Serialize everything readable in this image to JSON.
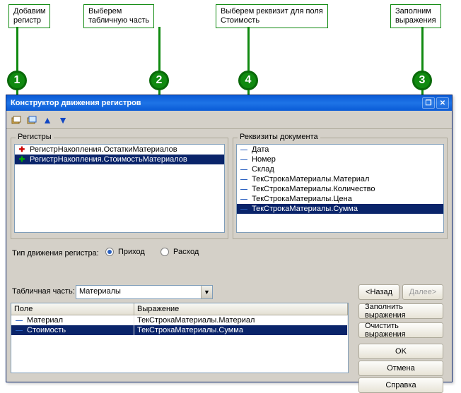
{
  "callouts": {
    "c1": "Добавим\nрегистр",
    "c2": "Выберем\nтабличную часть",
    "c3": "Заполним\nвыражения",
    "c4": "Выберем реквизит для поля\nСтоимость",
    "n1": "1",
    "n2": "2",
    "n3": "3",
    "n4": "4"
  },
  "window": {
    "title": "Конструктор движения регистров"
  },
  "groups": {
    "registers": "Регистры",
    "doc_attributes": "Реквизиты документа"
  },
  "registers_items": [
    {
      "icon": "plus-red",
      "text": "РегистрНакопления.ОстаткиМатериалов"
    },
    {
      "icon": "plus-green",
      "text": "РегистрНакопления.СтоимостьМатериалов",
      "selected": true
    }
  ],
  "doc_items": [
    {
      "icon": "dash-blue",
      "text": "Дата"
    },
    {
      "icon": "dash-blue",
      "text": "Номер"
    },
    {
      "icon": "dash-blue",
      "text": "Склад"
    },
    {
      "icon": "dash-blue",
      "text": "ТекСтрокаМатериалы.Материал"
    },
    {
      "icon": "dash-blue",
      "text": "ТекСтрокаМатериалы.Количество"
    },
    {
      "icon": "dash-blue",
      "text": "ТекСтрокаМатериалы.Цена"
    },
    {
      "icon": "dash-blue",
      "text": "ТекСтрокаМатериалы.Сумма",
      "selected": true
    }
  ],
  "movement_type": {
    "label": "Тип движения регистра:",
    "income": "Приход",
    "expense": "Расход"
  },
  "tabular": {
    "label": "Табличная часть:",
    "value": "Материалы"
  },
  "grid": {
    "col_field": "Поле",
    "col_expr": "Выражение",
    "rows": [
      {
        "field": "Материал",
        "expr": "ТекСтрокаМатериалы.Материал"
      },
      {
        "field": "Стоимость",
        "expr": "ТекСтрокаМатериалы.Сумма",
        "selected": true
      }
    ]
  },
  "buttons": {
    "back": "<Назад",
    "next": "Далее>",
    "fill": "Заполнить выражения",
    "clear": "Очистить выражения",
    "ok": "OK",
    "cancel": "Отмена",
    "help": "Справка"
  }
}
